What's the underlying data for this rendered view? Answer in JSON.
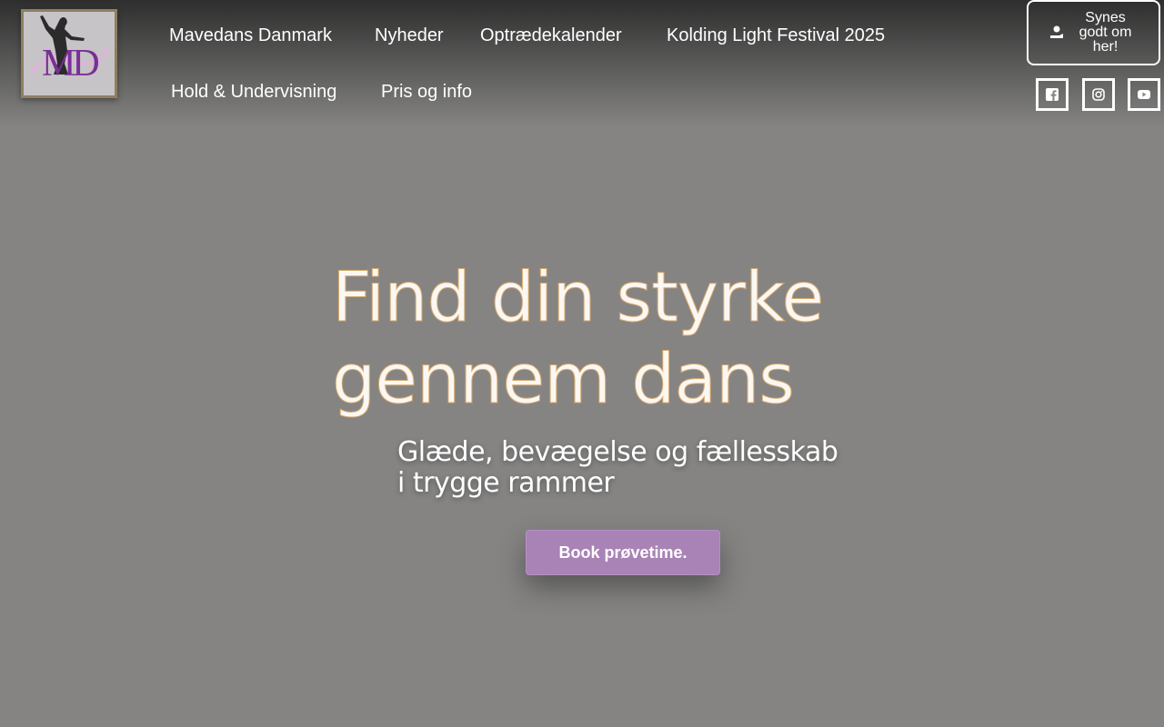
{
  "logo": {
    "text": "MD"
  },
  "nav": {
    "items": [
      {
        "label": "Mavedans Danmark"
      },
      {
        "label": "Nyheder"
      },
      {
        "label": "Optrædekalender"
      },
      {
        "label": "Kolding Light Festival 2025"
      },
      {
        "label": "Hold & Undervisning"
      },
      {
        "label": "Pris og info"
      }
    ]
  },
  "header_cta": {
    "label": "Synes godt om her!",
    "icon": "hand-heart-icon"
  },
  "social": [
    {
      "icon": "facebook-icon"
    },
    {
      "icon": "instagram-icon"
    },
    {
      "icon": "youtube-icon"
    }
  ],
  "hero": {
    "title_line1": "Find din styrke",
    "title_line2": "gennem dans",
    "subtitle_line1": "Glæde, bevægelse og fællesskab",
    "subtitle_line2": "i trygge rammer",
    "button_label": "Book prøvetime."
  },
  "colors": {
    "background": "#858483",
    "accent_button": "#a983b5",
    "title_stroke": "#d6a86a",
    "logo_purple": "#7a2f97"
  }
}
